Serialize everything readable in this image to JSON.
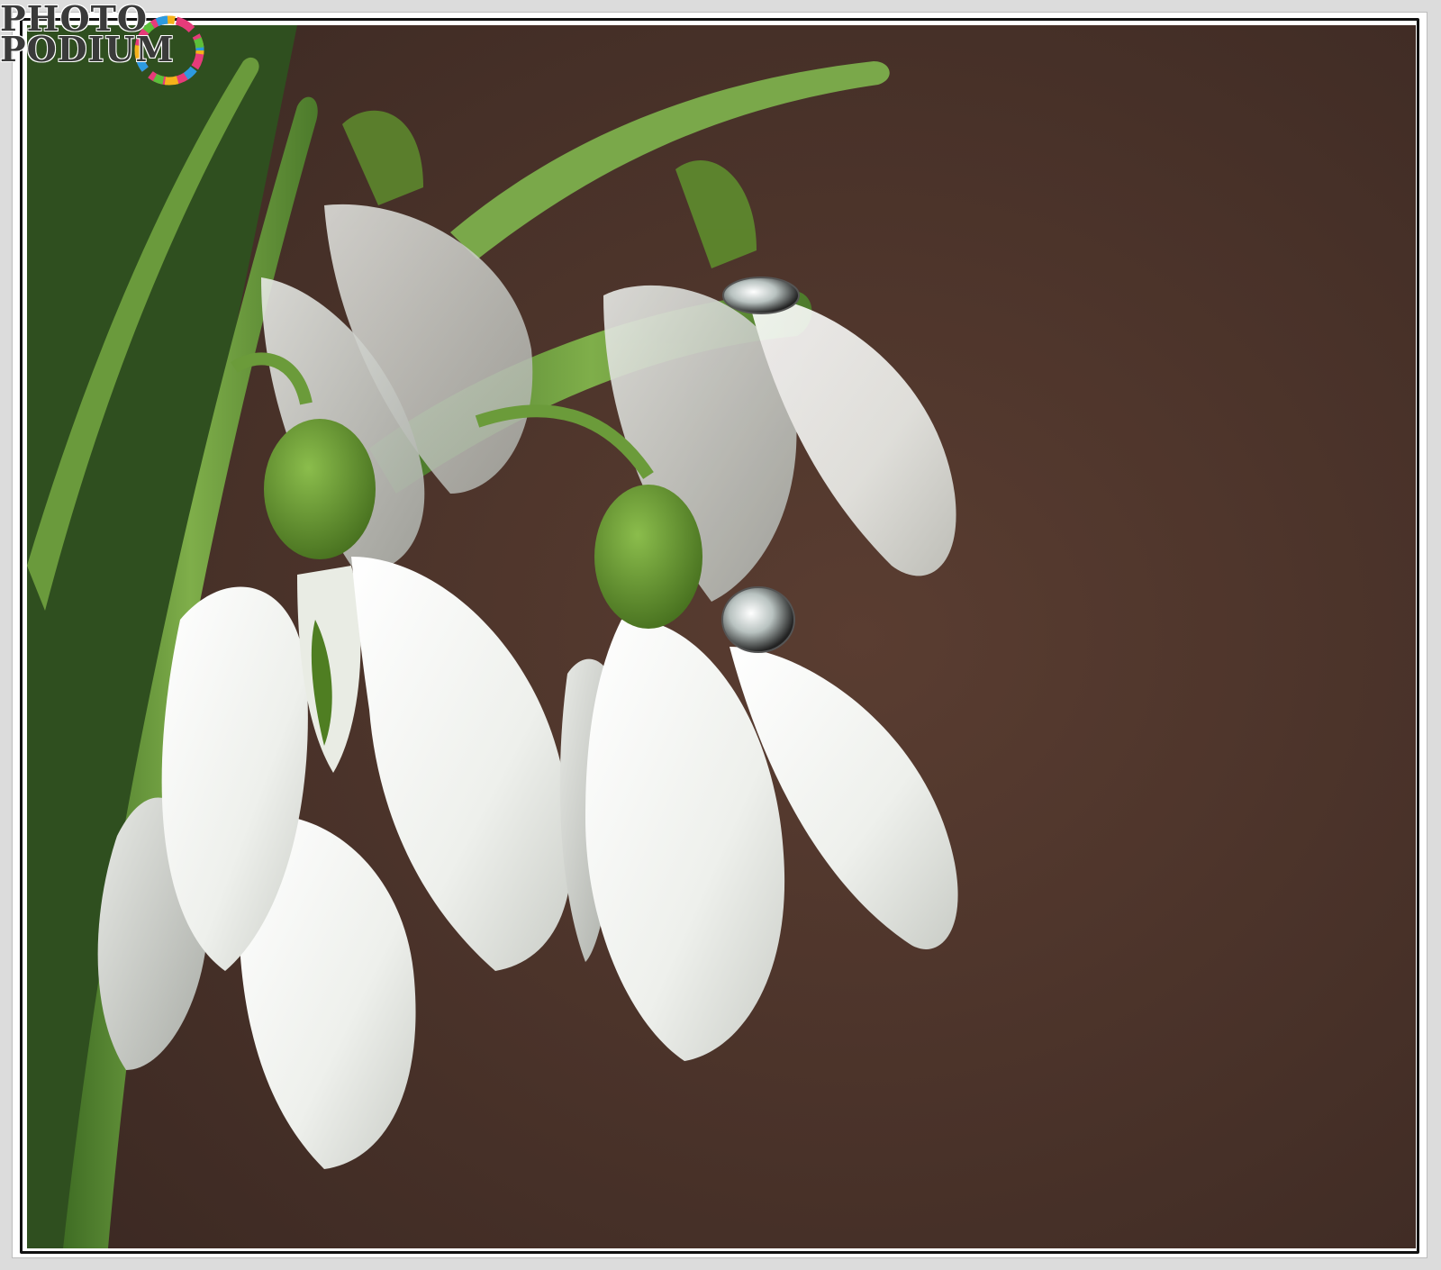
{
  "watermark": {
    "line1": "PHOTO",
    "line2": "PODIUM"
  },
  "colors": {
    "background": "#4a3229",
    "petal": "#f4f5f2",
    "leaf": "#6e9a3e",
    "ovary": "#5f8e2c",
    "frame": "#111111"
  }
}
